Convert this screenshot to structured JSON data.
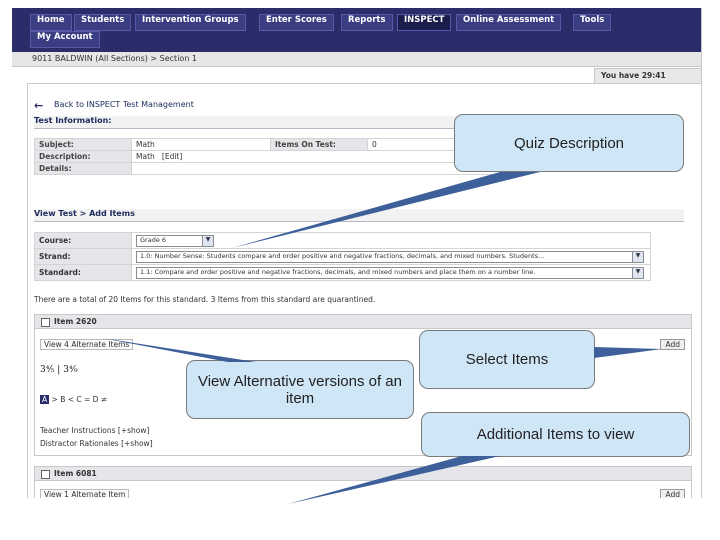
{
  "nav": {
    "items": [
      "Home",
      "Students",
      "Intervention Groups",
      "Enter Scores",
      "Reports",
      "INSPECT",
      "Online Assessment",
      "Tools"
    ],
    "account": "My Account"
  },
  "breadcrumb": "9011 BALDWIN (All Sections) > Section 1",
  "timer": "You have 29:41",
  "back_link": "Back to INSPECT Test Management",
  "test_info": {
    "heading": "Test Information:",
    "subject_label": "Subject:",
    "subject_value": "Math",
    "items_label": "Items On Test:",
    "items_value": "0",
    "description_label": "Description:",
    "description_value": "Math",
    "edit_label": "[Edit]",
    "details_label": "Details:"
  },
  "view_test": {
    "heading": "View Test > Add Items",
    "course_label": "Course:",
    "course_value": "Grade 6",
    "strand_label": "Strand:",
    "strand_value": "1.0: Number Sense: Students compare and order positive and negative fractions, decimals, and mixed numbers. Students...",
    "standard_label": "Standard:",
    "standard_value": "1.1: Compare and order positive and negative fractions, decimals, and mixed numbers and place them on a number line."
  },
  "total_line": "There are a total of 20 Items for this standard.  3 Items from this standard are quarantined.",
  "item1": {
    "title": "Item 2620",
    "alt_link": "View 4 Alternate Items",
    "add_label": "Add",
    "formula": "3⁴⁄₅  |  3⁴⁄₉",
    "choice_a": "A",
    "choices_rest": "  >   B  <   C  =   D  ≠",
    "teacher_instructions": "Teacher Instructions  [+show]",
    "distractor_rationales": "Distractor Rationales  [+show]"
  },
  "item2": {
    "title": "Item 6081",
    "alt_link": "View 1 Alternate Item",
    "add_label": "Add"
  },
  "callouts": {
    "quiz_description": "Quiz Description",
    "view_alternatives": "View Alternative versions of an item",
    "select_items": "Select Items",
    "additional_items": "Additional Items to view"
  },
  "colors": {
    "navbar": "#2b2d6b",
    "callout_fill": "#cfe6f7",
    "pointer_line": "#3d5f9a"
  }
}
